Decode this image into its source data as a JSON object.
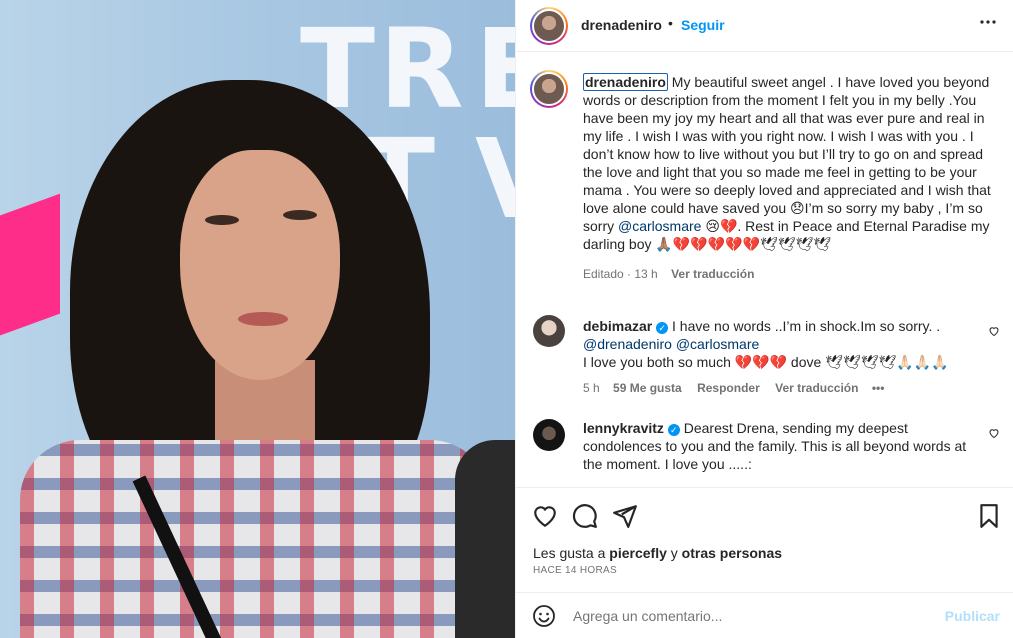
{
  "post": {
    "author": "drenadeniro",
    "follow_label": "Seguir",
    "separator": "•",
    "more_label": "•••"
  },
  "caption": {
    "username": "drenadeniro",
    "text_1": " My beautiful sweet angel . I have loved you beyond words or description from the moment I felt you in my belly .You have been my joy my heart and all that was ever pure and real in my life . I wish I was with you right now. I wish I was with you . I don’t know how to live without you but I’ll try to go on and spread the love and light that you so made me feel in getting to be your mama . You were so deeply loved and appreciated and I wish that love alone could have saved you 😞I’m so sorry my baby , I’m so sorry ",
    "mention": "@carlosmare",
    "text_2": " 😢💔. Rest in Peace and Eternal Paradise my darling boy 🙏🏽💔💔💔💔💔🕊🕊🕊🕊",
    "edited": "Editado · 13 h",
    "translate": "Ver traducción"
  },
  "comments": [
    {
      "username": "debimazar",
      "verified": true,
      "text_1": " I have no words ..I’m in shock.Im so sorry. .",
      "mention_1": "@drenadeniro",
      "mention_2": "@carlosmare",
      "text_2": "I love you both so much 💔💔💔 dove 🕊🕊🕊🕊🙏🏻🙏🏻🙏🏻",
      "time": "5 h",
      "likes": "59 Me gusta",
      "reply": "Responder",
      "translate": "Ver traducción",
      "more": "•••"
    },
    {
      "username": "lennykravitz",
      "verified": true,
      "text_1": " Dearest Drena, sending my deepest condolences to you and the family. This is all beyond words at the moment. I love you .....:"
    }
  ],
  "footer": {
    "likes_prefix": "Les gusta a ",
    "liker": "piercefly",
    "likes_middle": " y ",
    "likes_others": "otras personas",
    "time_ago": "HACE 14 HORAS",
    "comment_placeholder": "Agrega un comentario...",
    "publish_label": "Publicar"
  },
  "photo": {
    "banner_letters": [
      "TR",
      "E",
      "T",
      "V"
    ]
  },
  "colors": {
    "accent_blue": "#0095f6",
    "mention": "#00376b",
    "muted": "#737373",
    "publish_disabled": "#b2dffc"
  }
}
